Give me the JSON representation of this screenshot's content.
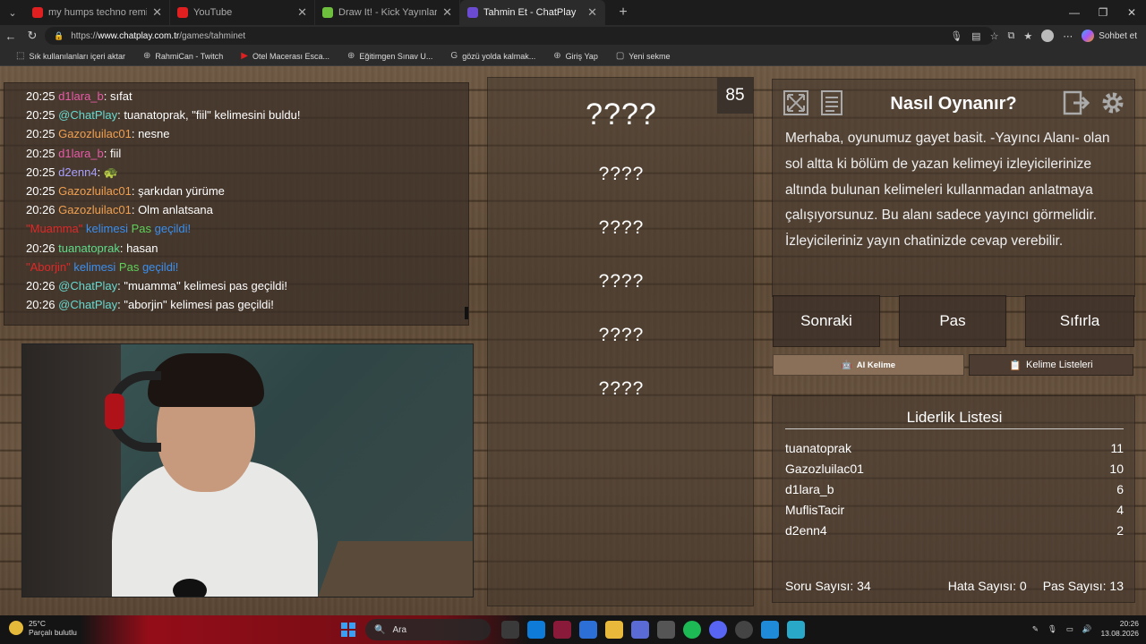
{
  "browser": {
    "tabs": [
      {
        "title": "my humps techno remix - YouTub",
        "favicon_color": "#e02020",
        "active": false
      },
      {
        "title": "YouTube",
        "favicon_color": "#e02020",
        "active": false
      },
      {
        "title": "Draw It! - Kick Yayınları İçin Ç",
        "favicon_color": "#6fbf3f",
        "active": false
      },
      {
        "title": "Tahmin Et - ChatPlay",
        "favicon_color": "#6b4bd1",
        "active": true
      }
    ],
    "url_prefix": "https://",
    "url_host": "www.chatplay.com.tr",
    "url_path": "/games/tahminet",
    "copilot_label": "Sohbet et",
    "bookmarks": [
      {
        "label": "Sık kullanılanları içeri aktar",
        "icon": "import-icon"
      },
      {
        "label": "RahmiCan - Twitch",
        "icon": "globe-icon"
      },
      {
        "label": "Otel Macerası Esca...",
        "icon": "youtube-icon"
      },
      {
        "label": "Eğitimgen Sınav U...",
        "icon": "globe-icon"
      },
      {
        "label": "gözü yolda kalmak...",
        "icon": "google-icon"
      },
      {
        "label": "Giriş Yap",
        "icon": "globe-icon"
      },
      {
        "label": "Yeni sekme",
        "icon": "tab-icon"
      }
    ]
  },
  "chat": {
    "lines": [
      {
        "time": "20:25",
        "user": "d1lara_b",
        "user_color": "#e85aa8",
        "sep": ": ",
        "msg": "sıfat",
        "msg_color": "#ffffff"
      },
      {
        "time": "20:25",
        "user": "@ChatPlay",
        "user_color": "#66d9d0",
        "sep": ": ",
        "msg": "tuanatoprak, \"fiil\" kelimesini buldu!",
        "msg_color": "#ffffff"
      },
      {
        "time": "20:25",
        "user": "Gazozluilac01",
        "user_color": "#f0a050",
        "sep": ": ",
        "msg": "nesne",
        "msg_color": "#ffffff"
      },
      {
        "time": "20:25",
        "user": "d1lara_b",
        "user_color": "#e85aa8",
        "sep": ": ",
        "msg": "fiil",
        "msg_color": "#ffffff"
      },
      {
        "time": "20:25",
        "user": "d2enn4",
        "user_color": "#a8a0ff",
        "sep": ": ",
        "msg": "🐢",
        "msg_color": "#ffffff"
      },
      {
        "time": "20:25",
        "user": "Gazozluilac01",
        "user_color": "#f0a050",
        "sep": ": ",
        "msg": "şarkıdan yürüme",
        "msg_color": "#ffffff"
      },
      {
        "time": "20:26",
        "user": "Gazozluilac01",
        "user_color": "#f0a050",
        "sep": ": ",
        "msg": "Olm anlatsana",
        "msg_color": "#ffffff"
      },
      {
        "time": "",
        "user": "\"Muamma\"",
        "user_color": "#e02828",
        "sep": " ",
        "msg": "kelimesi",
        "msg_color": "#3a8ff0",
        "pas": "Pas",
        "tail": "geçildi!"
      },
      {
        "time": "20:26",
        "user": "tuanatoprak",
        "user_color": "#5fdc8a",
        "sep": ": ",
        "msg": "hasan",
        "msg_color": "#ffffff"
      },
      {
        "time": "",
        "user": "\"Aborjin\"",
        "user_color": "#e02828",
        "sep": " ",
        "msg": "kelimesi",
        "msg_color": "#3a8ff0",
        "pas": "Pas",
        "tail": "geçildi!"
      },
      {
        "time": "20:26",
        "user": "@ChatPlay",
        "user_color": "#66d9d0",
        "sep": ": ",
        "msg": "\"muamma\" kelimesi pas geçildi!",
        "msg_color": "#ffffff"
      },
      {
        "time": "20:26",
        "user": "@ChatPlay",
        "user_color": "#66d9d0",
        "sep": ": ",
        "msg": "\"aborjin\" kelimesi pas geçildi!",
        "msg_color": "#ffffff"
      }
    ],
    "pas_color": "#5fd05a"
  },
  "game": {
    "timer": "85",
    "main_word": "????",
    "forbidden_words": [
      "????",
      "????",
      "????",
      "????",
      "????"
    ]
  },
  "howto": {
    "title": "Nasıl Oynanır?",
    "text": "Merhaba, oyunumuz gayet basit. -Yayıncı Alanı- olan sol altta ki bölüm de yazan kelimeyi izleyicilerinize altında bulunan kelimeleri kullanmadan anlatmaya çalışıyorsunuz. Bu alanı sadece yayıncı görmelidir. İzleyicileriniz yayın chatinizde cevap verebilir."
  },
  "controls": {
    "next": "Sonraki",
    "pass": "Pas",
    "reset": "Sıfırla",
    "ai_word": "AI Kelime",
    "word_lists": "Kelime Listeleri"
  },
  "leaderboard": {
    "title": "Liderlik Listesi",
    "rows": [
      {
        "name": "tuanatoprak",
        "score": "11"
      },
      {
        "name": "Gazozluilac01",
        "score": "10"
      },
      {
        "name": "d1lara_b",
        "score": "6"
      },
      {
        "name": "MuflisTacir",
        "score": "4"
      },
      {
        "name": "d2enn4",
        "score": "2"
      }
    ],
    "questions": "Soru Sayısı: 34",
    "errors": "Hata Sayısı: 0",
    "passes": "Pas Sayısı: 13"
  },
  "taskbar": {
    "temp": "25°C",
    "weather": "Parçalı bulutlu",
    "search_placeholder": "Ara",
    "time": "20:26",
    "date": "13.08.2026"
  }
}
